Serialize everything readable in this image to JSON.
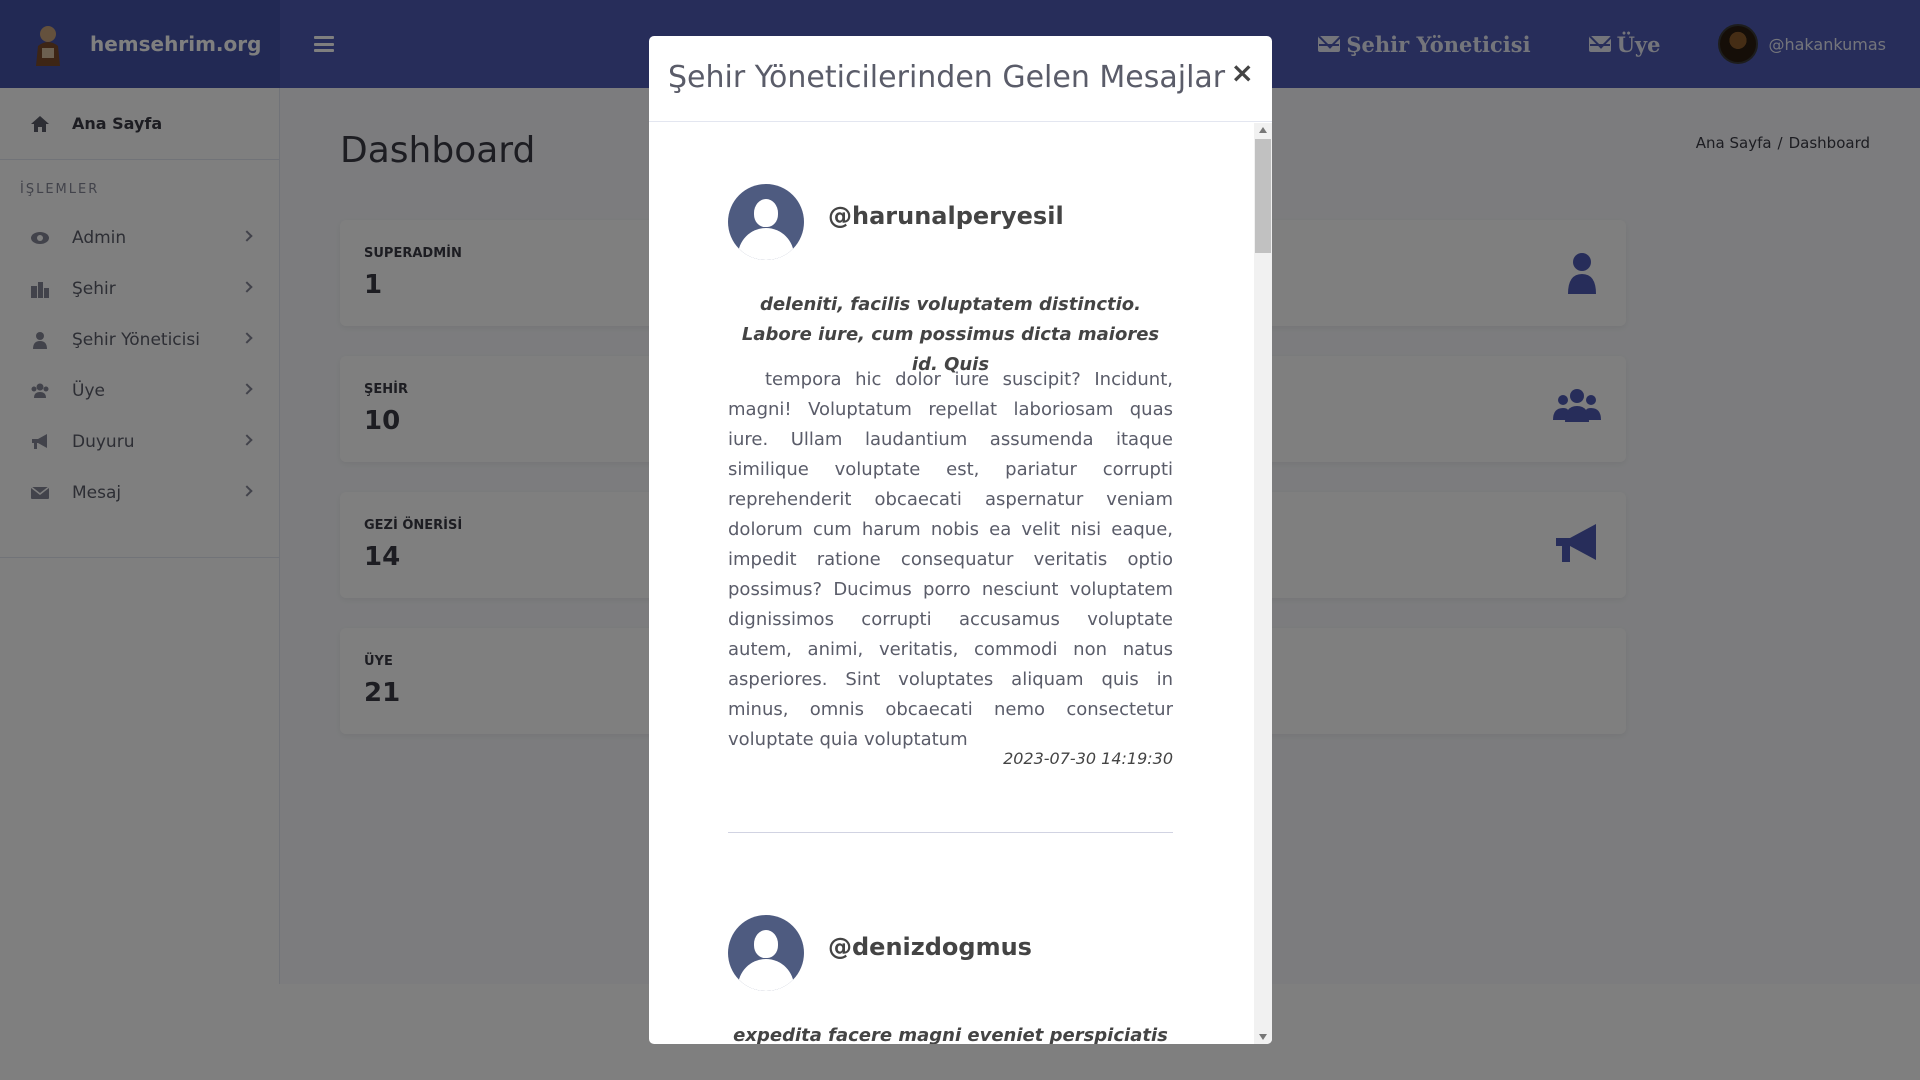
{
  "brand": {
    "name": "hemsehrim.org"
  },
  "topnav": {
    "links": [
      {
        "label": "Şehir Yöneticisi",
        "icon": "envelope-icon"
      },
      {
        "label": "Üye",
        "icon": "envelope-icon"
      }
    ],
    "user": {
      "name": "@hakankumas"
    }
  },
  "sidebar": {
    "home": {
      "label": "Ana Sayfa",
      "icon": "home-icon"
    },
    "heading": "İŞLEMLER",
    "items": [
      {
        "label": "Admin",
        "icon": "eye-icon"
      },
      {
        "label": "Şehir",
        "icon": "city-icon"
      },
      {
        "label": "Şehir Yöneticisi",
        "icon": "user-icon"
      },
      {
        "label": "Üye",
        "icon": "users-icon"
      },
      {
        "label": "Duyuru",
        "icon": "megaphone-icon"
      },
      {
        "label": "Mesaj",
        "icon": "envelope-icon"
      }
    ]
  },
  "main": {
    "title": "Dashboard",
    "breadcrumb": {
      "home": "Ana Sayfa",
      "separator": "/",
      "current": "Dashboard"
    },
    "cards": [
      {
        "label": "SUPERADMİN",
        "value": "1",
        "icon": "user-icon"
      },
      {
        "label": "ŞEHİR",
        "value": "10",
        "icon": "users-icon"
      },
      {
        "label": "GEZİ ÖNERİSİ",
        "value": "14",
        "icon": "megaphone-icon"
      },
      {
        "label": "ÜYE",
        "value": "21",
        "icon": ""
      }
    ],
    "accent_color": "#4e5bb5"
  },
  "modal": {
    "title": "Şehir Yöneticilerinden Gelen Mesajlar",
    "close_label": "×",
    "messages": [
      {
        "user": "@harunalperyesil",
        "quote": "deleniti, facilis voluptatem distinctio. Labore iure, cum possimus dicta maiores id. Quis",
        "text": "tempora hic dolor iure suscipit? Incidunt, magni! Voluptatum repellat laboriosam quas iure. Ullam laudantium assumenda itaque similique voluptate est, pariatur corrupti reprehenderit obcaecati aspernatur veniam dolorum cum harum nobis ea velit nisi eaque, impedit ratione consequatur veritatis optio possimus? Ducimus porro nesciunt voluptatem dignissimos corrupti accusamus voluptate autem, animi, veritatis, commodi non natus asperiores. Sint voluptates aliquam quis in minus, omnis obcaecati nemo consectetur voluptate quia voluptatum",
        "date": "2023-07-30 14:19:30"
      },
      {
        "user": "@denizdogmus",
        "quote": "expedita facere magni eveniet perspiciatis iste"
      }
    ]
  }
}
